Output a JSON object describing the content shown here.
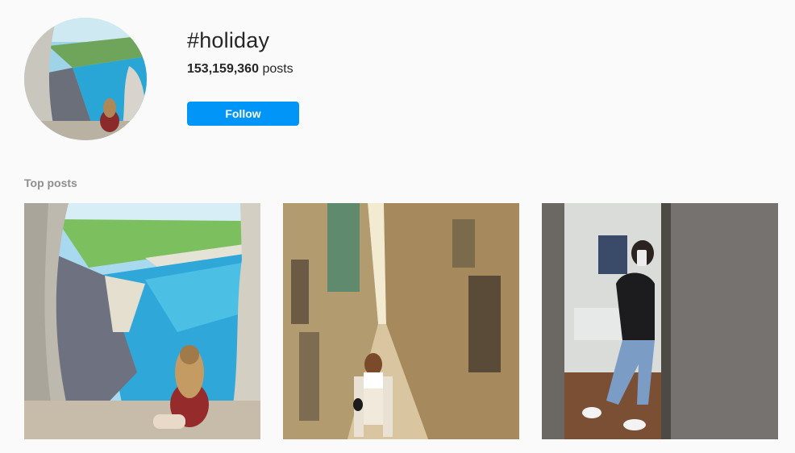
{
  "header": {
    "hashtag": "#holiday",
    "post_count": "153,159,360",
    "posts_suffix": "posts",
    "follow_label": "Follow",
    "follow_color": "#0095f6"
  },
  "sections": {
    "top_posts_label": "Top posts"
  },
  "posts": [
    {
      "image": "cliff-cave-beach-photo"
    },
    {
      "image": "narrow-street-woman-photo"
    },
    {
      "image": "mirror-selfie-photo"
    }
  ]
}
